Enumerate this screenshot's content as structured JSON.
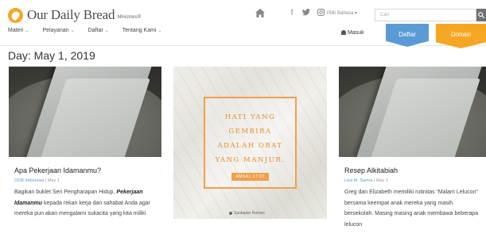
{
  "header": {
    "logo_text": "Our Daily Bread",
    "logo_sub": "Ministries®",
    "nav": [
      {
        "label": "Materi"
      },
      {
        "label": "Pelayanan"
      },
      {
        "label": "Daftar"
      },
      {
        "label": "Tentang Kami"
      }
    ],
    "nav_caret": "⌄",
    "language": "Pilih Bahasa ▾",
    "search_placeholder": "Cari",
    "login_label": "Masuk",
    "register_label": "Daftar",
    "donate_label": "Donasi",
    "colors": {
      "register": "#5b9bd5",
      "donate": "#f5a623"
    }
  },
  "page": {
    "title": "Day: May 1, 2019"
  },
  "cards": [
    {
      "title": "Apa Pekerjaan Idamanmu?",
      "author": "ODB Indonesia",
      "date": "May 1",
      "excerpt_before": "Bagikan buklet Seri Pengharapan Hidup, ",
      "excerpt_em": "Pekerjaan Idamanmu",
      "excerpt_after": " kepada rekan kerja dan sahabat Anda agar mereka pun akan mengalami sukacita yang kita miliki"
    },
    {
      "verse": "HATI YANG\nGEMBIRA\nADALAH OBAT\nYANG MANJUR.",
      "reference": "AMSAL 17:22",
      "credit": "Santapan Rohani"
    },
    {
      "title": "Resep Alkitabiah",
      "author": "Lisa M. Samra",
      "date": "May 1",
      "excerpt": "Greg dan Elizabeth memiliki rutinitas “Malam Lelucon” bersama keempat anak mereka yang masih bersekolah. Masing masing anak membawa beberapa lelucon"
    }
  ]
}
